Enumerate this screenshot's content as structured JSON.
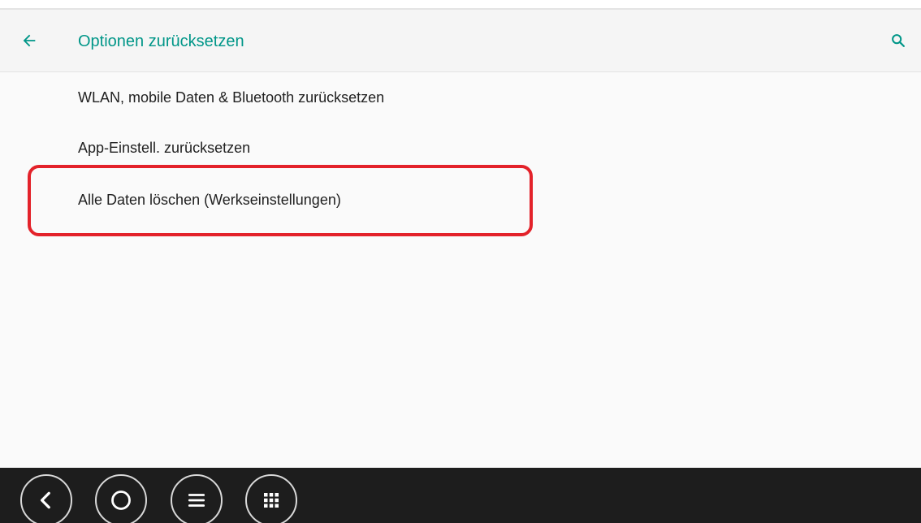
{
  "toolbar": {
    "title": "Optionen zurücksetzen",
    "back_icon": "arrow-back-icon",
    "search_icon": "search-icon",
    "accent_color": "#009688"
  },
  "list": {
    "items": [
      {
        "label": "WLAN, mobile Daten & Bluetooth zurücksetzen"
      },
      {
        "label": "App-Einstell. zurücksetzen"
      },
      {
        "label": "Alle Daten löschen (Werkseinstellungen)"
      }
    ],
    "highlight_color": "#e3222a"
  },
  "navbar": {
    "buttons": [
      {
        "icon": "back-chevron-icon"
      },
      {
        "icon": "home-circle-icon"
      },
      {
        "icon": "menu-lines-icon"
      },
      {
        "icon": "apps-grid-icon"
      }
    ]
  }
}
